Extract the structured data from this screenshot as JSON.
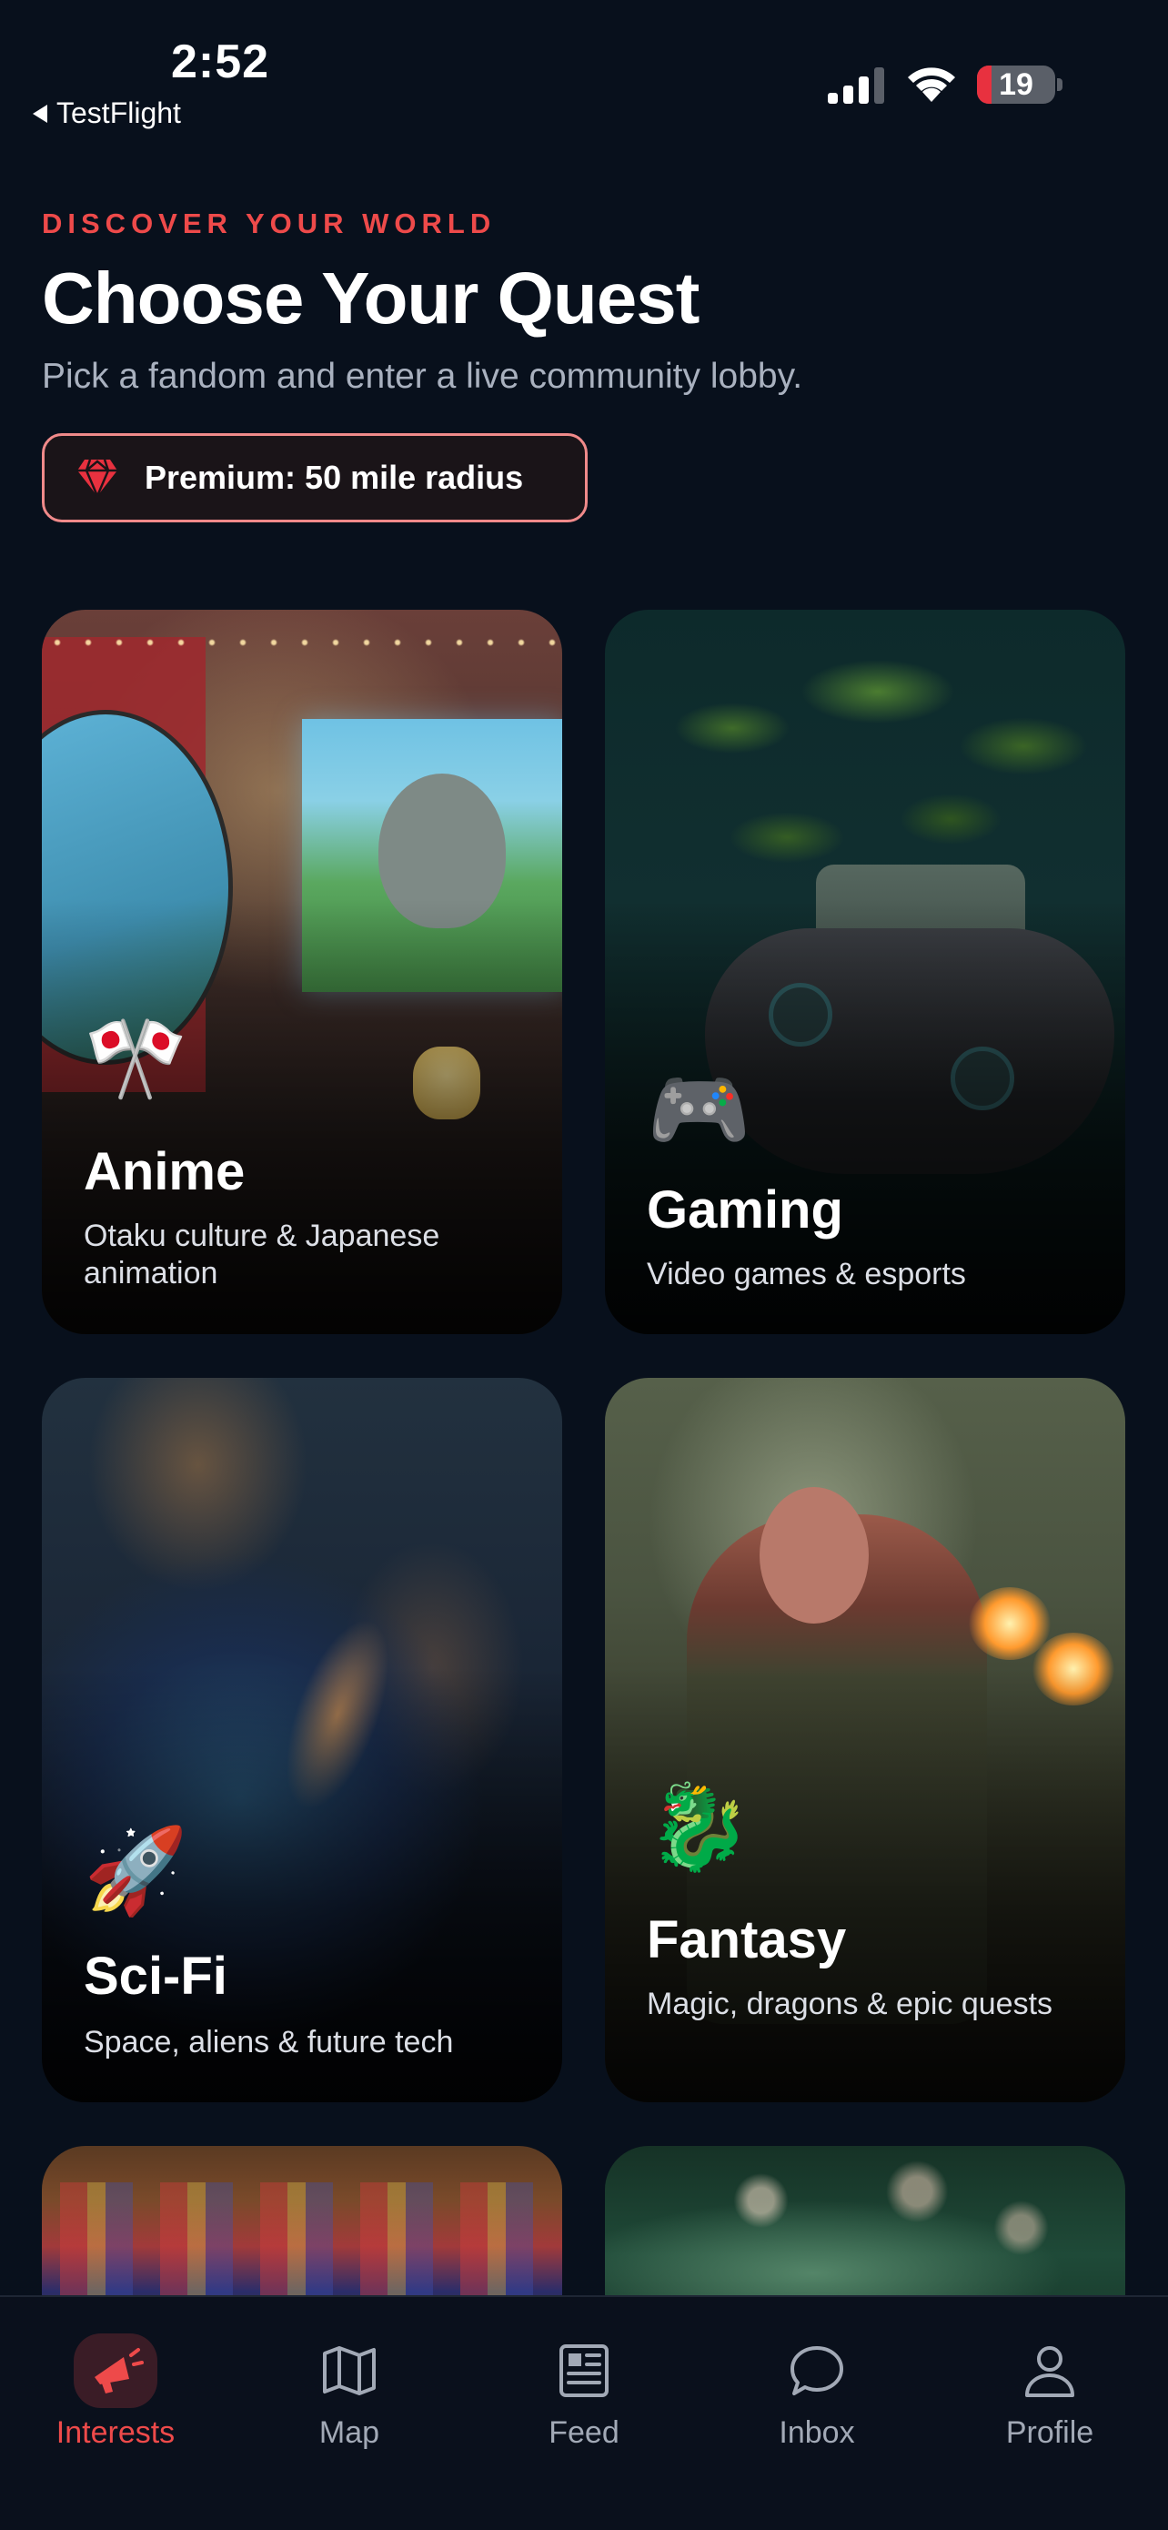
{
  "status_bar": {
    "time": "2:52",
    "back_app": "TestFlight",
    "battery_level": "19",
    "battery_fraction": 0.19
  },
  "header": {
    "eyebrow": "DISCOVER YOUR WORLD",
    "title": "Choose Your Quest",
    "subtitle": "Pick a fandom and enter a live community lobby.",
    "premium_badge": "Premium: 50 mile radius"
  },
  "cards": [
    {
      "emoji": "🎌",
      "title": "Anime",
      "description": "Otaku culture & Japanese animation"
    },
    {
      "emoji": "🎮",
      "title": "Gaming",
      "description": "Video games & esports"
    },
    {
      "emoji": "🚀",
      "title": "Sci-Fi",
      "description": "Space, aliens & future tech"
    },
    {
      "emoji": "🐉",
      "title": "Fantasy",
      "description": "Magic, dragons & epic quests"
    }
  ],
  "tab_bar": {
    "tabs": [
      {
        "label": "Interests",
        "icon": "megaphone-icon",
        "active": true
      },
      {
        "label": "Map",
        "icon": "map-icon",
        "active": false
      },
      {
        "label": "Feed",
        "icon": "newspaper-icon",
        "active": false
      },
      {
        "label": "Inbox",
        "icon": "chat-bubble-icon",
        "active": false
      },
      {
        "label": "Profile",
        "icon": "person-icon",
        "active": false
      }
    ]
  },
  "colors": {
    "background": "#08101c",
    "accent": "#ee4a4a",
    "premium_border": "#f08a8a",
    "muted_text": "#a9b1bf"
  }
}
